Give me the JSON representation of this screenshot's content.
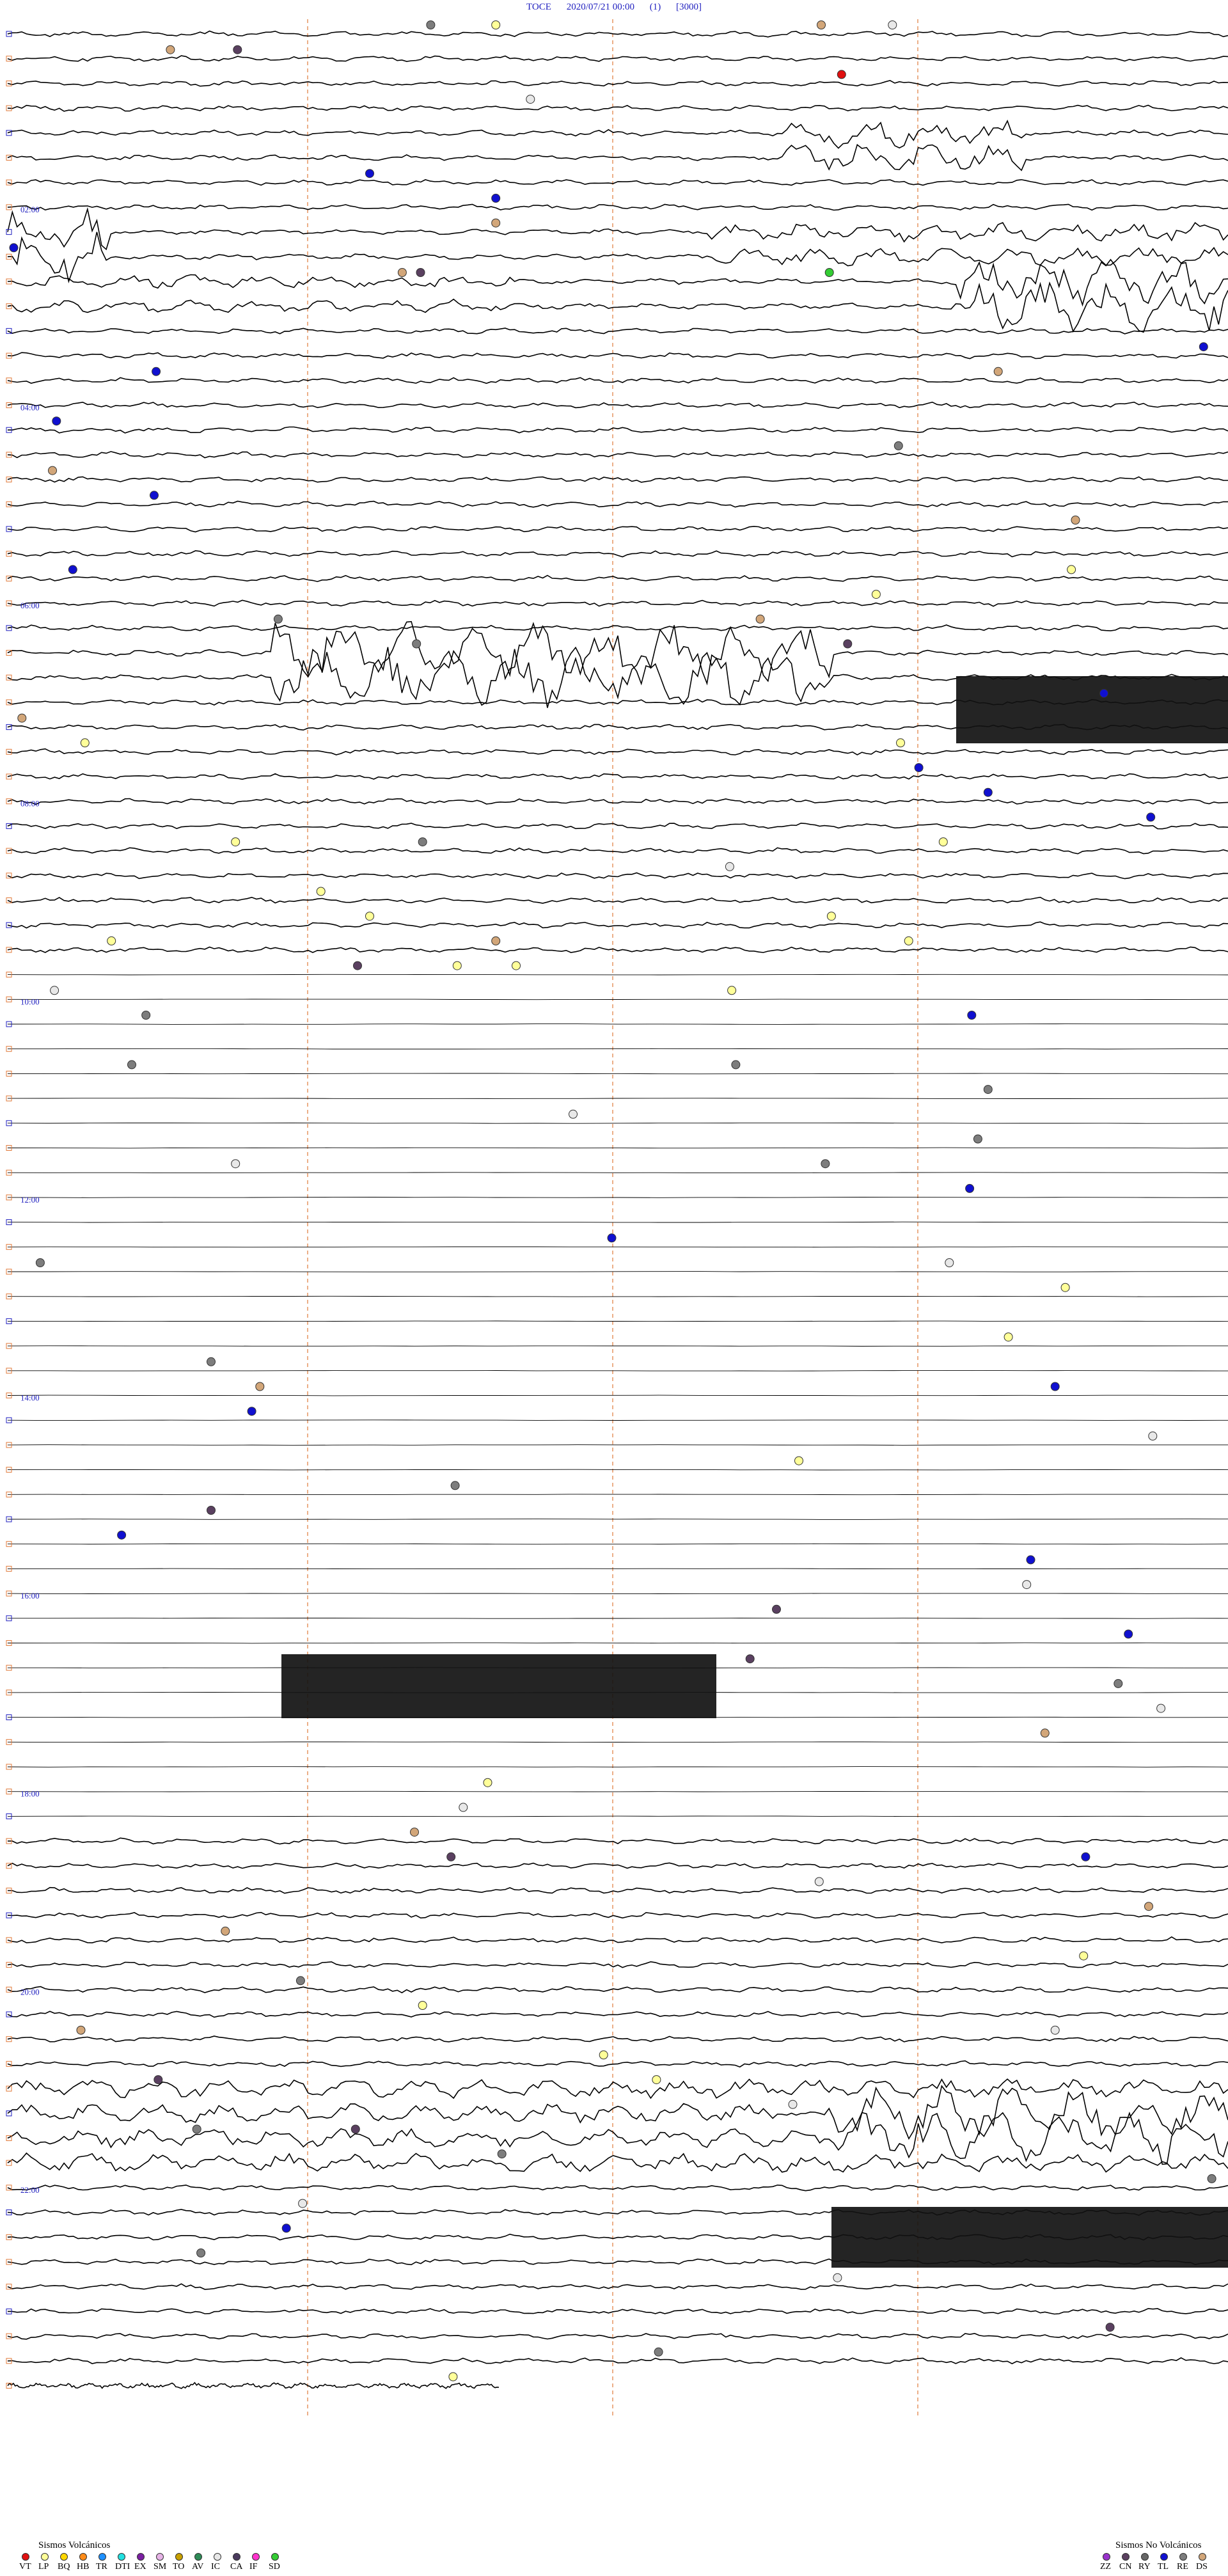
{
  "header": {
    "station": "TOCE",
    "datetime": "2020/07/21 00:00",
    "component": "(1)",
    "scale": "[3000]"
  },
  "chart_data": {
    "type": "helicorder",
    "rows": 96,
    "hour_labels": [
      "02:00",
      "04:00",
      "06:00",
      "08:00",
      "10:00",
      "12:00",
      "14:00",
      "16:00",
      "18:00",
      "20:00",
      "22:00"
    ],
    "events": [
      {
        "row": 0,
        "min": 20.8,
        "code": "RE"
      },
      {
        "row": 0,
        "min": 43.5,
        "code": "IC"
      },
      {
        "row": 0,
        "min": 24.0,
        "code": "LP"
      },
      {
        "row": 0,
        "min": 40.0,
        "code": "DS"
      },
      {
        "row": 1,
        "min": 11.3,
        "code": "CN"
      },
      {
        "row": 1,
        "min": 8.0,
        "code": "DS"
      },
      {
        "row": 2,
        "min": 41.0,
        "code": "VT"
      },
      {
        "row": 3,
        "min": 25.7,
        "code": "IC"
      },
      {
        "row": 6,
        "min": 17.8,
        "code": "TL"
      },
      {
        "row": 7,
        "min": 24.0,
        "code": "TL"
      },
      {
        "row": 8,
        "min": 24.0,
        "code": "DS"
      },
      {
        "row": 9,
        "min": 0.3,
        "code": "TL"
      },
      {
        "row": 10,
        "min": 20.3,
        "code": "CN"
      },
      {
        "row": 10,
        "min": 40.4,
        "code": "SD"
      },
      {
        "row": 10,
        "min": 19.4,
        "code": "DS"
      },
      {
        "row": 13,
        "min": 58.8,
        "code": "TL"
      },
      {
        "row": 14,
        "min": 7.3,
        "code": "TL"
      },
      {
        "row": 14,
        "min": 48.7,
        "code": "DS"
      },
      {
        "row": 16,
        "min": 2.4,
        "code": "TL"
      },
      {
        "row": 17,
        "min": 43.8,
        "code": "RE"
      },
      {
        "row": 18,
        "min": 2.2,
        "code": "DS"
      },
      {
        "row": 19,
        "min": 7.2,
        "code": "TL"
      },
      {
        "row": 20,
        "min": 52.5,
        "code": "DS"
      },
      {
        "row": 22,
        "min": 52.3,
        "code": "LP"
      },
      {
        "row": 22,
        "min": 3.2,
        "code": "TL"
      },
      {
        "row": 23,
        "min": 42.7,
        "code": "LP"
      },
      {
        "row": 24,
        "min": 13.3,
        "code": "RE"
      },
      {
        "row": 24,
        "min": 37.0,
        "code": "DS"
      },
      {
        "row": 25,
        "min": 20.1,
        "code": "RE"
      },
      {
        "row": 25,
        "min": 41.3,
        "code": "CN"
      },
      {
        "row": 27,
        "min": 53.9,
        "code": "TL"
      },
      {
        "row": 28,
        "min": 0.7,
        "code": "DS"
      },
      {
        "row": 29,
        "min": 3.8,
        "code": "LP"
      },
      {
        "row": 29,
        "min": 43.9,
        "code": "LP"
      },
      {
        "row": 30,
        "min": 44.8,
        "code": "TL"
      },
      {
        "row": 31,
        "min": 48.2,
        "code": "TL"
      },
      {
        "row": 32,
        "min": 56.2,
        "code": "TL"
      },
      {
        "row": 33,
        "min": 20.4,
        "code": "RE"
      },
      {
        "row": 33,
        "min": 11.2,
        "code": "LP"
      },
      {
        "row": 33,
        "min": 46.0,
        "code": "LP"
      },
      {
        "row": 34,
        "min": 35.5,
        "code": "IC"
      },
      {
        "row": 35,
        "min": 15.4,
        "code": "LP"
      },
      {
        "row": 36,
        "min": 40.5,
        "code": "LP"
      },
      {
        "row": 36,
        "min": 17.8,
        "code": "LP"
      },
      {
        "row": 37,
        "min": 24.0,
        "code": "DS"
      },
      {
        "row": 37,
        "min": 44.3,
        "code": "LP"
      },
      {
        "row": 37,
        "min": 5.1,
        "code": "LP"
      },
      {
        "row": 38,
        "min": 17.2,
        "code": "CN"
      },
      {
        "row": 38,
        "min": 22.1,
        "code": "LP"
      },
      {
        "row": 38,
        "min": 25.0,
        "code": "LP"
      },
      {
        "row": 39,
        "min": 2.3,
        "code": "IC"
      },
      {
        "row": 39,
        "min": 35.6,
        "code": "LP"
      },
      {
        "row": 40,
        "min": 6.8,
        "code": "RE"
      },
      {
        "row": 40,
        "min": 47.4,
        "code": "TL"
      },
      {
        "row": 42,
        "min": 6.1,
        "code": "RE"
      },
      {
        "row": 42,
        "min": 35.8,
        "code": "RE"
      },
      {
        "row": 43,
        "min": 48.2,
        "code": "RE"
      },
      {
        "row": 44,
        "min": 27.8,
        "code": "IC"
      },
      {
        "row": 45,
        "min": 47.7,
        "code": "RE"
      },
      {
        "row": 46,
        "min": 11.2,
        "code": "IC"
      },
      {
        "row": 46,
        "min": 40.2,
        "code": "RE"
      },
      {
        "row": 47,
        "min": 47.3,
        "code": "TL"
      },
      {
        "row": 49,
        "min": 29.7,
        "code": "TL"
      },
      {
        "row": 50,
        "min": 1.6,
        "code": "RE"
      },
      {
        "row": 50,
        "min": 46.3,
        "code": "IC"
      },
      {
        "row": 51,
        "min": 52.0,
        "code": "LP"
      },
      {
        "row": 53,
        "min": 49.2,
        "code": "LP"
      },
      {
        "row": 54,
        "min": 10.0,
        "code": "RE"
      },
      {
        "row": 55,
        "min": 12.4,
        "code": "DS"
      },
      {
        "row": 55,
        "min": 51.5,
        "code": "TL"
      },
      {
        "row": 56,
        "min": 12.0,
        "code": "TL"
      },
      {
        "row": 57,
        "min": 56.3,
        "code": "IC"
      },
      {
        "row": 58,
        "min": 38.9,
        "code": "LP"
      },
      {
        "row": 59,
        "min": 22.0,
        "code": "RE"
      },
      {
        "row": 60,
        "min": 10.0,
        "code": "CN"
      },
      {
        "row": 61,
        "min": 5.6,
        "code": "TL"
      },
      {
        "row": 62,
        "min": 50.3,
        "code": "TL"
      },
      {
        "row": 63,
        "min": 50.1,
        "code": "IC"
      },
      {
        "row": 64,
        "min": 37.8,
        "code": "CN"
      },
      {
        "row": 65,
        "min": 55.1,
        "code": "TL"
      },
      {
        "row": 66,
        "min": 36.5,
        "code": "CN"
      },
      {
        "row": 67,
        "min": 54.6,
        "code": "RE"
      },
      {
        "row": 68,
        "min": 56.7,
        "code": "IC"
      },
      {
        "row": 69,
        "min": 51.0,
        "code": "DS"
      },
      {
        "row": 71,
        "min": 23.6,
        "code": "LP"
      },
      {
        "row": 72,
        "min": 22.4,
        "code": "IC"
      },
      {
        "row": 73,
        "min": 20.0,
        "code": "DS"
      },
      {
        "row": 74,
        "min": 21.8,
        "code": "CN"
      },
      {
        "row": 74,
        "min": 53.0,
        "code": "TL"
      },
      {
        "row": 75,
        "min": 39.9,
        "code": "IC"
      },
      {
        "row": 76,
        "min": 56.1,
        "code": "DS"
      },
      {
        "row": 77,
        "min": 10.7,
        "code": "DS"
      },
      {
        "row": 78,
        "min": 52.9,
        "code": "LP"
      },
      {
        "row": 79,
        "min": 14.4,
        "code": "RE"
      },
      {
        "row": 80,
        "min": 20.4,
        "code": "LP"
      },
      {
        "row": 81,
        "min": 3.6,
        "code": "DS"
      },
      {
        "row": 81,
        "min": 51.5,
        "code": "IC"
      },
      {
        "row": 82,
        "min": 29.3,
        "code": "LP"
      },
      {
        "row": 83,
        "min": 7.4,
        "code": "CN"
      },
      {
        "row": 83,
        "min": 31.9,
        "code": "LP"
      },
      {
        "row": 84,
        "min": 38.6,
        "code": "IC"
      },
      {
        "row": 85,
        "min": 9.3,
        "code": "RE"
      },
      {
        "row": 85,
        "min": 17.1,
        "code": "CN"
      },
      {
        "row": 86,
        "min": 24.3,
        "code": "RE"
      },
      {
        "row": 87,
        "min": 59.2,
        "code": "RE"
      },
      {
        "row": 88,
        "min": 14.5,
        "code": "IC"
      },
      {
        "row": 89,
        "min": 13.7,
        "code": "TL"
      },
      {
        "row": 90,
        "min": 9.5,
        "code": "RE"
      },
      {
        "row": 91,
        "min": 40.8,
        "code": "IC"
      },
      {
        "row": 93,
        "min": 54.2,
        "code": "CN"
      },
      {
        "row": 94,
        "min": 32.0,
        "code": "RE"
      },
      {
        "row": 95,
        "min": 21.9,
        "code": "LP"
      }
    ]
  },
  "legend": {
    "volcanic_title": "Sismos Volcánicos",
    "volcanic": [
      {
        "code": "VT",
        "color": "#e01010"
      },
      {
        "code": "LP",
        "color": "#ffff99"
      },
      {
        "code": "BQ",
        "color": "#ffd700"
      },
      {
        "code": "HB",
        "color": "#ff8c1a"
      },
      {
        "code": "TR",
        "color": "#1e90ff"
      },
      {
        "code": "DTI",
        "color": "#22e0e0"
      },
      {
        "code": "EX",
        "color": "#7b1fa2"
      },
      {
        "code": "SM",
        "color": "#e6b3e6"
      },
      {
        "code": "TO",
        "color": "#c8a000"
      },
      {
        "code": "AV",
        "color": "#2e8b57"
      },
      {
        "code": "IC",
        "color": "#e8e8e8"
      },
      {
        "code": "CA",
        "color": "#4b3b5e"
      },
      {
        "code": "IF",
        "color": "#ff33cc"
      },
      {
        "code": "SD",
        "color": "#33cc33"
      }
    ],
    "nonvolcanic_title": "Sismos No Volcánicos",
    "nonvolcanic": [
      {
        "code": "ZZ",
        "color": "#9932cc"
      },
      {
        "code": "CN",
        "color": "#5a4060"
      },
      {
        "code": "RY",
        "color": "#666666"
      },
      {
        "code": "TL",
        "color": "#1010d0"
      },
      {
        "code": "RE",
        "color": "#7d7d7d"
      },
      {
        "code": "DS",
        "color": "#d2a679"
      }
    ]
  }
}
